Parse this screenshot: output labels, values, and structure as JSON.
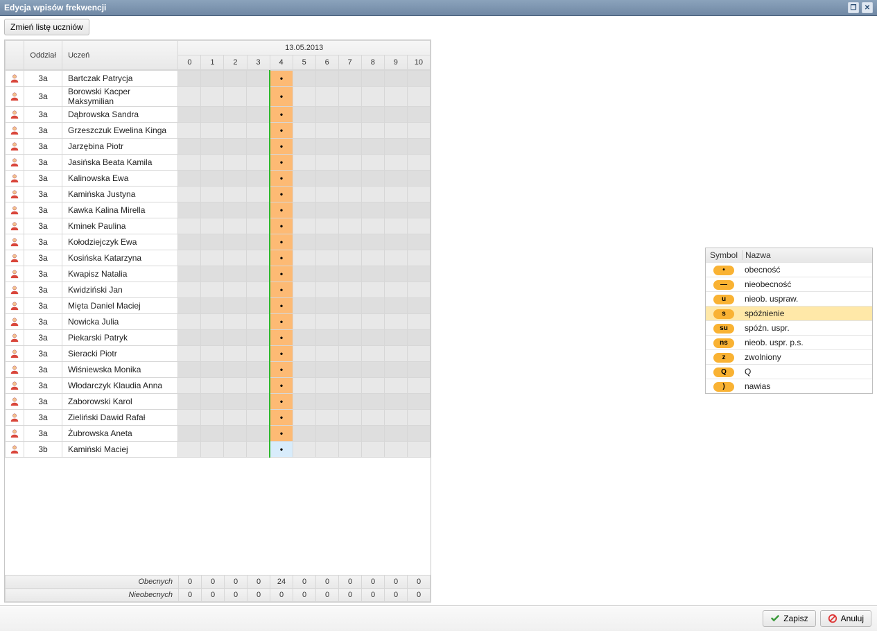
{
  "window": {
    "title": "Edycja wpisów frekwencji"
  },
  "toolbar": {
    "change_list": "Zmień listę uczniów"
  },
  "headers": {
    "oddzial": "Oddział",
    "uczen": "Uczeń",
    "date": "13.05.2013",
    "periods": [
      "0",
      "1",
      "2",
      "3",
      "4",
      "5",
      "6",
      "7",
      "8",
      "9",
      "10"
    ]
  },
  "students": [
    {
      "odd": "3a",
      "name": "Bartczak Patrycja",
      "mark_col": 4
    },
    {
      "odd": "3a",
      "name": "Borowski Kacper Maksymilian",
      "mark_col": 4
    },
    {
      "odd": "3a",
      "name": "Dąbrowska Sandra",
      "mark_col": 4
    },
    {
      "odd": "3a",
      "name": "Grzeszczuk Ewelina Kinga",
      "mark_col": 4
    },
    {
      "odd": "3a",
      "name": "Jarzębina Piotr",
      "mark_col": 4
    },
    {
      "odd": "3a",
      "name": "Jasińska Beata Kamila",
      "mark_col": 4
    },
    {
      "odd": "3a",
      "name": "Kalinowska Ewa",
      "mark_col": 4
    },
    {
      "odd": "3a",
      "name": "Kamińska Justyna",
      "mark_col": 4
    },
    {
      "odd": "3a",
      "name": "Kawka Kalina Mirella",
      "mark_col": 4
    },
    {
      "odd": "3a",
      "name": "Kminek Paulina",
      "mark_col": 4
    },
    {
      "odd": "3a",
      "name": "Kołodziejczyk Ewa",
      "mark_col": 4
    },
    {
      "odd": "3a",
      "name": "Kosińska Katarzyna",
      "mark_col": 4
    },
    {
      "odd": "3a",
      "name": "Kwapisz Natalia",
      "mark_col": 4
    },
    {
      "odd": "3a",
      "name": "Kwidziński Jan",
      "mark_col": 4
    },
    {
      "odd": "3a",
      "name": "Mięta Daniel Maciej",
      "mark_col": 4
    },
    {
      "odd": "3a",
      "name": "Nowicka Julia",
      "mark_col": 4
    },
    {
      "odd": "3a",
      "name": "Piekarski Patryk",
      "mark_col": 4
    },
    {
      "odd": "3a",
      "name": "Sieracki Piotr",
      "mark_col": 4
    },
    {
      "odd": "3a",
      "name": "Wiśniewska Monika",
      "mark_col": 4
    },
    {
      "odd": "3a",
      "name": "Włodarczyk Klaudia Anna",
      "mark_col": 4
    },
    {
      "odd": "3a",
      "name": "Zaborowski Karol",
      "mark_col": 4
    },
    {
      "odd": "3a",
      "name": "Zieliński Dawid Rafał",
      "mark_col": 4
    },
    {
      "odd": "3a",
      "name": "Żubrowska Aneta",
      "mark_col": 4
    },
    {
      "odd": "3b",
      "name": "Kamiński Maciej",
      "mark_col": 4,
      "alt": true
    }
  ],
  "summary": {
    "present_label": "Obecnych",
    "absent_label": "Nieobecnych",
    "present": [
      "0",
      "0",
      "0",
      "0",
      "24",
      "0",
      "0",
      "0",
      "0",
      "0",
      "0"
    ],
    "absent": [
      "0",
      "0",
      "0",
      "0",
      "0",
      "0",
      "0",
      "0",
      "0",
      "0",
      "0"
    ]
  },
  "legend": {
    "head_symbol": "Symbol",
    "head_name": "Nazwa",
    "rows": [
      {
        "sym": "•",
        "name": "obecność"
      },
      {
        "sym": "—",
        "name": "nieobecność"
      },
      {
        "sym": "u",
        "name": "nieob. uspraw."
      },
      {
        "sym": "s",
        "name": "spóźnienie",
        "selected": true
      },
      {
        "sym": "su",
        "name": "spóźn. uspr."
      },
      {
        "sym": "ns",
        "name": "nieob. uspr. p.s."
      },
      {
        "sym": "z",
        "name": "zwolniony"
      },
      {
        "sym": "Q",
        "name": "Q"
      },
      {
        "sym": ")",
        "name": "nawias"
      }
    ]
  },
  "footer": {
    "save": "Zapisz",
    "cancel": "Anuluj"
  }
}
